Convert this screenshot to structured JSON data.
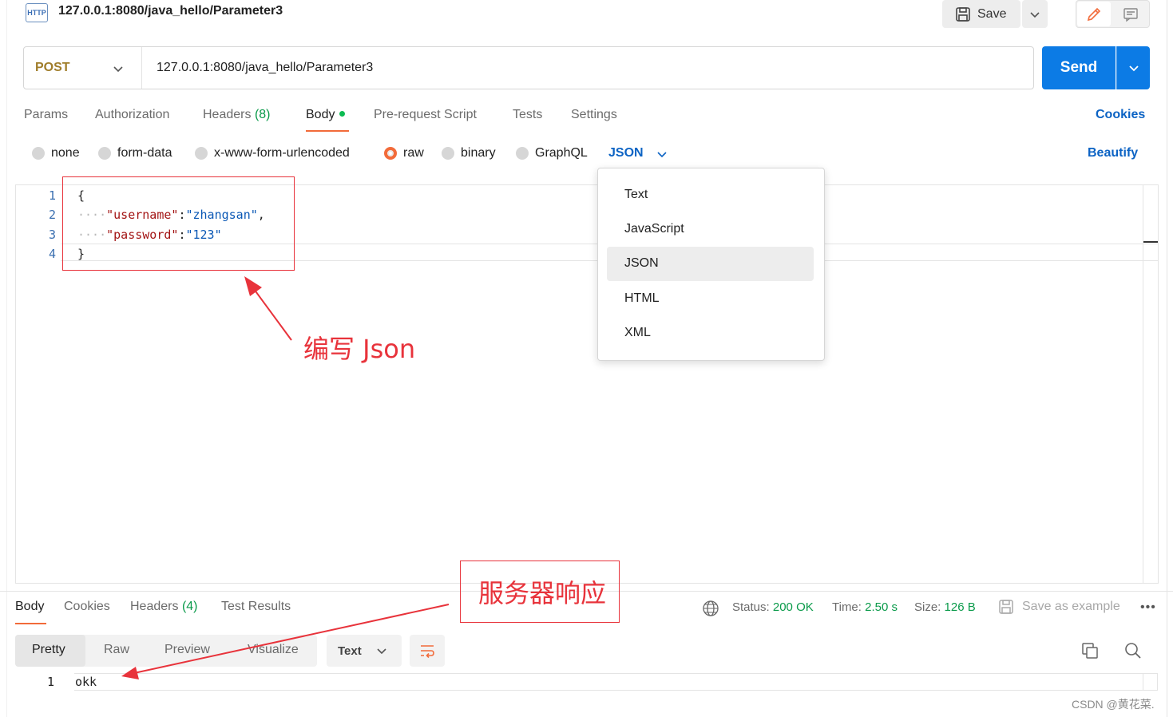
{
  "request": {
    "badge": "HTTP",
    "title": "127.0.0.1:8080/java_hello/Parameter3",
    "save_label": "Save",
    "method": "POST",
    "url": "127.0.0.1:8080/java_hello/Parameter3",
    "send_label": "Send"
  },
  "tabs": {
    "params": "Params",
    "authorization": "Authorization",
    "headers": "Headers",
    "headers_count": "(8)",
    "body": "Body",
    "prerequest": "Pre-request Script",
    "tests": "Tests",
    "settings": "Settings",
    "cookies": "Cookies"
  },
  "body_modes": {
    "none": "none",
    "form_data": "form-data",
    "urlencoded": "x-www-form-urlencoded",
    "raw": "raw",
    "binary": "binary",
    "graphql": "GraphQL",
    "selected": "raw",
    "language": "JSON",
    "beautify": "Beautify"
  },
  "editor": {
    "line_numbers": [
      "1",
      "2",
      "3",
      "4"
    ],
    "lines": {
      "l1": "{",
      "l2_key": "\"username\"",
      "l2_colon": ":",
      "l2_val": "\"zhangsan\"",
      "l2_comma": ",",
      "l3_key": "\"password\"",
      "l3_colon": ":",
      "l3_val": "\"123\"",
      "l4": "}"
    }
  },
  "language_dropdown": {
    "options": [
      "Text",
      "JavaScript",
      "JSON",
      "HTML",
      "XML"
    ],
    "highlighted": "JSON"
  },
  "annotations": {
    "write_json": "编写 Json",
    "server_response": "服务器响应"
  },
  "response": {
    "tabs": {
      "body": "Body",
      "cookies": "Cookies",
      "headers": "Headers",
      "headers_count": "(4)",
      "test_results": "Test Results"
    },
    "status_label": "Status:",
    "status_value": "200 OK",
    "time_label": "Time:",
    "time_value": "2.50 s",
    "size_label": "Size:",
    "size_value": "126 B",
    "save_example": "Save as example",
    "views": {
      "pretty": "Pretty",
      "raw": "Raw",
      "preview": "Preview",
      "visualize": "Visualize"
    },
    "format": "Text",
    "line_number": "1",
    "content": "okk"
  },
  "watermark": "CSDN @黄花菜.",
  "colors": {
    "accent_orange": "#f26b3a",
    "send_blue": "#0c7be5",
    "link_blue": "#0c63c4",
    "annotation_red": "#e8333b",
    "status_green": "#0a9a4a"
  },
  "icons": {
    "save": "floppy-disk-icon",
    "edit": "pencil-icon",
    "comment": "comment-icon",
    "globe": "globe-icon",
    "copy": "copy-icon",
    "search": "search-icon",
    "wrap": "wrap-lines-icon"
  }
}
